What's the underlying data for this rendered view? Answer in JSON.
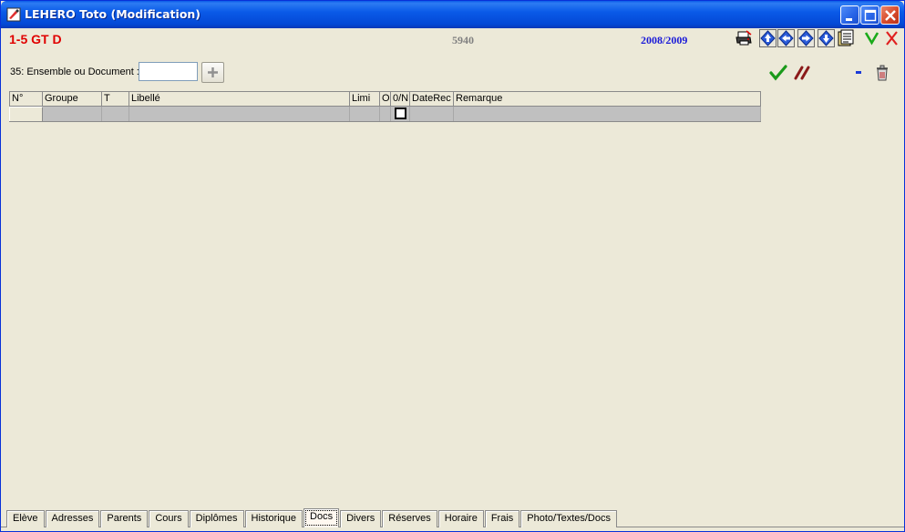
{
  "window": {
    "title": "LEHERO Toto (Modification)"
  },
  "header": {
    "class_code": "1-5 GT D",
    "record_number": "5940",
    "school_year": "2008/2009"
  },
  "document_filter": {
    "label": "35: Ensemble ou Document :",
    "value": "",
    "placeholder": ""
  },
  "grid": {
    "columns": [
      "N°",
      "Groupe",
      "T",
      "Libellé",
      "Limi",
      "O",
      "0/N",
      "DateRec",
      "Remarque"
    ]
  },
  "tabs": [
    {
      "label": "Elève"
    },
    {
      "label": "Adresses"
    },
    {
      "label": "Parents"
    },
    {
      "label": "Cours"
    },
    {
      "label": "Diplômes"
    },
    {
      "label": "Historique"
    },
    {
      "label": "Docs",
      "active": true
    },
    {
      "label": "Divers"
    },
    {
      "label": "Réserves"
    },
    {
      "label": "Horaire"
    },
    {
      "label": "Frais"
    },
    {
      "label": "Photo/Textes/Docs"
    }
  ],
  "colors": {
    "titlebar": "#0a5ae8",
    "class_code": "#e00000",
    "school_year": "#1a1ad8",
    "record_number": "#808080",
    "validate": "#1a9a1a",
    "cancel": "#8b1a1a"
  },
  "icons": {
    "app": "pencil-icon",
    "print": "printer-icon",
    "first": "arrow-up-icon",
    "previous": "arrow-left-icon",
    "next": "arrow-right-icon",
    "last": "arrow-down-icon",
    "notes": "document-icon",
    "ok": "check-icon",
    "close": "close-icon",
    "validate": "checkmark-icon",
    "cancel": "cancel-strokes-icon",
    "remove": "minus-icon",
    "delete": "trash-icon",
    "add": "plus-icon"
  }
}
